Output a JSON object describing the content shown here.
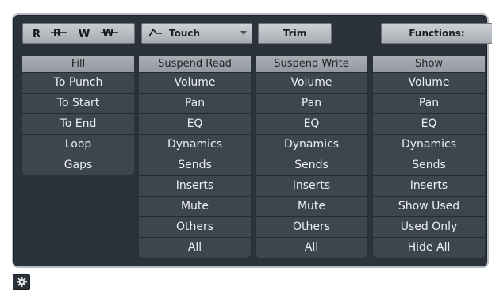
{
  "toolbar": {
    "read_label": "R",
    "write_label": "W",
    "automation_mode": "Touch",
    "trim_label": "Trim",
    "functions_label": "Functions:"
  },
  "columns": {
    "fill": {
      "header": "Fill",
      "items": [
        "To Punch",
        "To Start",
        "To End",
        "Loop",
        "Gaps"
      ]
    },
    "suspend_read": {
      "header": "Suspend Read",
      "items": [
        "Volume",
        "Pan",
        "EQ",
        "Dynamics",
        "Sends",
        "Inserts",
        "Mute",
        "Others",
        "All"
      ]
    },
    "suspend_write": {
      "header": "Suspend Write",
      "items": [
        "Volume",
        "Pan",
        "EQ",
        "Dynamics",
        "Sends",
        "Inserts",
        "Mute",
        "Others",
        "All"
      ]
    },
    "show": {
      "header": "Show",
      "items": [
        "Volume",
        "Pan",
        "EQ",
        "Dynamics",
        "Sends",
        "Inserts",
        "Show Used",
        "Used Only",
        "Hide All"
      ]
    }
  },
  "icons": {
    "read_all": "read-all-icon",
    "write_all": "write-all-icon",
    "touch_mode": "touch-ramp-icon",
    "dropdown": "chevron-down-icon",
    "settings": "gear-icon"
  },
  "colors": {
    "panel_bg": "#2b323a",
    "cell_bg": "#3d464f",
    "header_bg": "#a9afb5",
    "button_bg": "#c3c8cd",
    "text_light": "#eef1f3"
  }
}
